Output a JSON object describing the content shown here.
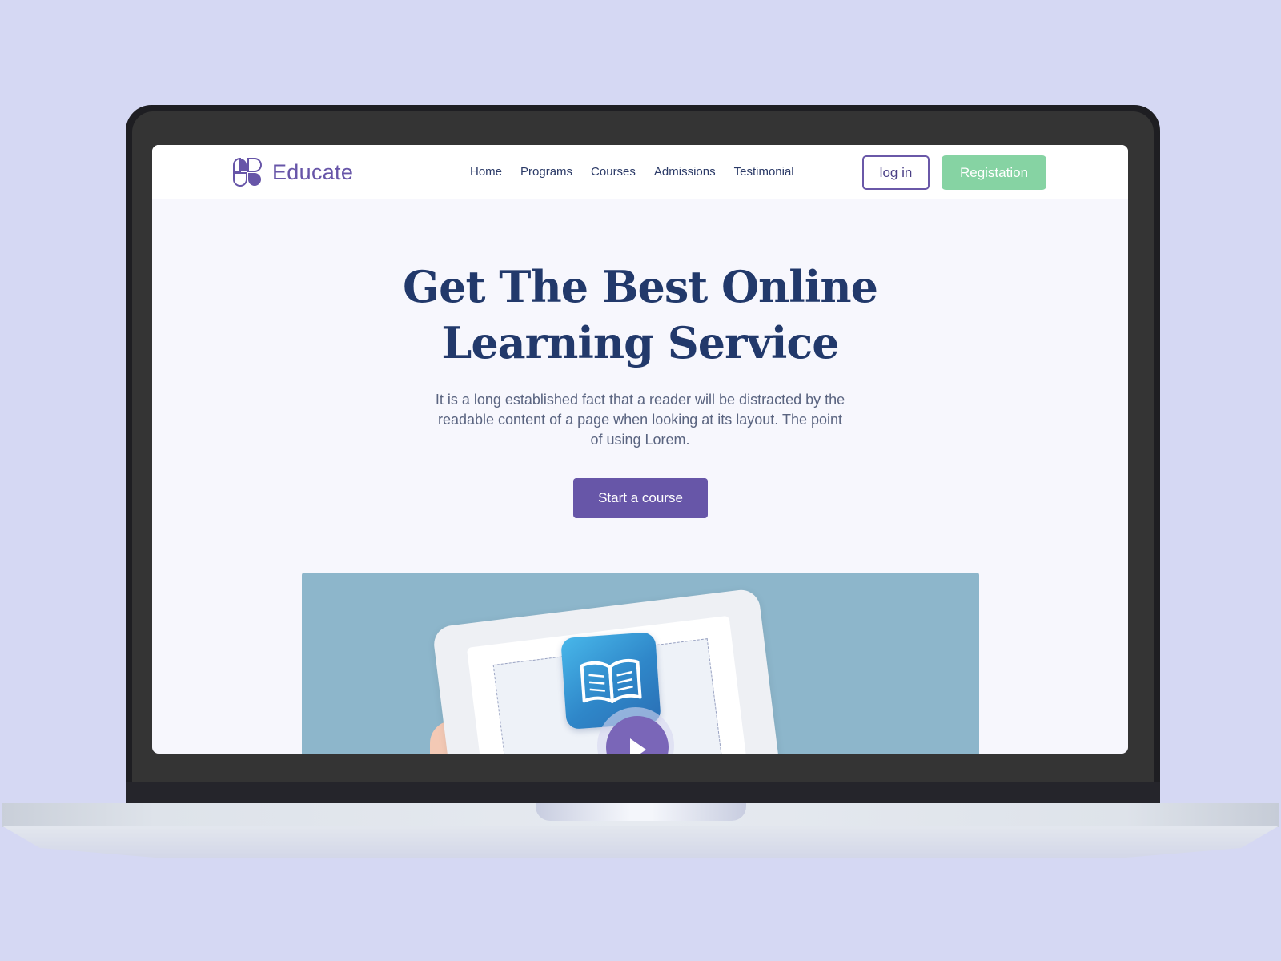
{
  "brand": {
    "name": "Educate",
    "accent": "#6755a8",
    "logo_icon": "clover-logo-icon"
  },
  "nav": {
    "links": [
      "Home",
      "Programs",
      "Courses",
      "Admissions",
      "Testimonial"
    ],
    "login_label": "log in",
    "register_label": "Registation",
    "register_color": "#86d3a3"
  },
  "hero": {
    "title_line1": "Get The Best Online",
    "title_line2": "Learning Service",
    "description": "It is a long established fact that a reader will be distracted by the readable content of a page when looking at its layout. The point of using Lorem.",
    "cta_label": "Start a course",
    "cta_color": "#6756a8",
    "title_color": "#22396b"
  },
  "media": {
    "background": "#8db6cb",
    "app_icon": "open-book-icon",
    "play_icon": "play-icon"
  },
  "frame": {
    "page_background": "#d5d8f3"
  }
}
